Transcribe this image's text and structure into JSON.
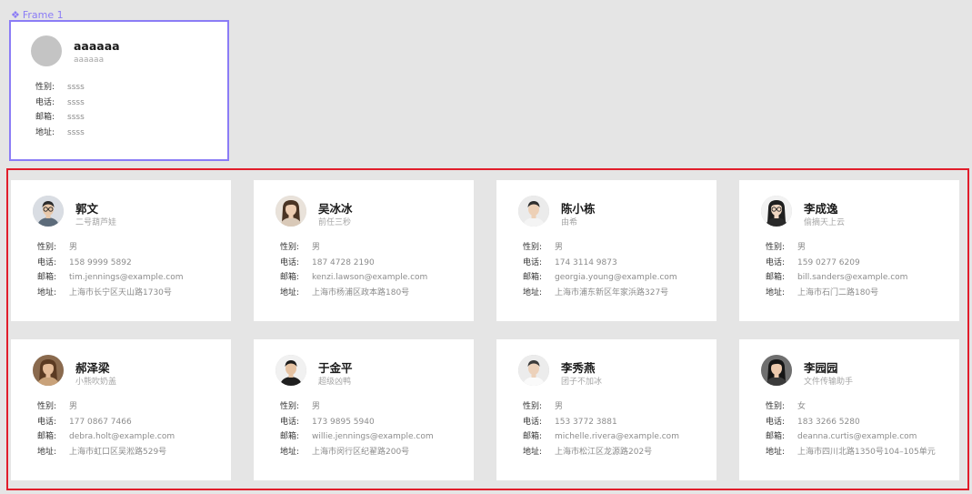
{
  "frame": {
    "label": "Frame 1",
    "component_icon": "component-icon",
    "accent_color": "#8b7cf6",
    "card": {
      "name": "aaaaaa",
      "nickname": "aaaaaa",
      "labels": [
        "性别:",
        "电话:",
        "邮箱:",
        "地址:"
      ],
      "values": [
        "ssss",
        "ssss",
        "ssss",
        "ssss"
      ]
    }
  },
  "selection_color": "#e11d2b",
  "labels": {
    "gender": "性别:",
    "phone": "电话:",
    "email": "邮箱:",
    "address": "地址:"
  },
  "cards": [
    {
      "name": "郭文",
      "nickname": "二号葫芦娃",
      "gender": "男",
      "phone": "158 9999 5892",
      "email": "tim.jennings@example.com",
      "address": "上海市长宁区天山路1730号",
      "avatar": "avatar-man-glasses"
    },
    {
      "name": "吴冰冰",
      "nickname": "前任三秒",
      "gender": "男",
      "phone": "187 4728 2190",
      "email": "kenzi.lawson@example.com",
      "address": "上海市杨浦区政本路180号",
      "avatar": "avatar-woman-long-hair"
    },
    {
      "name": "陈小栋",
      "nickname": "由希",
      "gender": "男",
      "phone": "174 3114 9873",
      "email": "georgia.young@example.com",
      "address": "上海市浦东新区年家浜路327号",
      "avatar": "avatar-man-short-hair"
    },
    {
      "name": "李成逸",
      "nickname": "偷摘天上云",
      "gender": "男",
      "phone": "159 0277 6209",
      "email": "bill.sanders@example.com",
      "address": "上海市石门二路180号",
      "avatar": "avatar-woman-glasses"
    },
    {
      "name": "郝泽梁",
      "nickname": "小熊吹奶盖",
      "gender": "男",
      "phone": "177 0867 7466",
      "email": "debra.holt@example.com",
      "address": "上海市虹口区吴淞路529号",
      "avatar": "avatar-woman-curly-hair"
    },
    {
      "name": "于金平",
      "nickname": "超级凶鸭",
      "gender": "男",
      "phone": "173 9895 5940",
      "email": "willie.jennings@example.com",
      "address": "上海市闵行区纪翟路200号",
      "avatar": "avatar-man-suit"
    },
    {
      "name": "李秀燕",
      "nickname": "团子不加冰",
      "gender": "男",
      "phone": "153 3772 3881",
      "email": "michelle.rivera@example.com",
      "address": "上海市松江区龙源路202号",
      "avatar": "avatar-man-white-shirt"
    },
    {
      "name": "李园园",
      "nickname": "文件传输助手",
      "gender": "女",
      "phone": "183 3266 5280",
      "email": "deanna.curtis@example.com",
      "address": "上海市四川北路1350号104–105单元",
      "avatar": "avatar-woman-dark-hair"
    }
  ]
}
